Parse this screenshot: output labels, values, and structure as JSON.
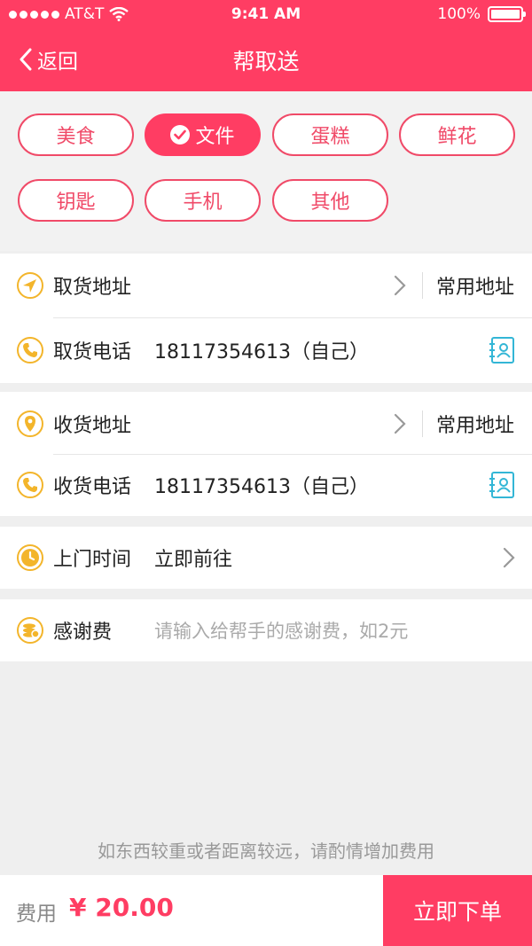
{
  "status_bar": {
    "carrier": "AT&T",
    "time": "9:41 AM",
    "battery": "100%"
  },
  "nav": {
    "back_label": "返回",
    "title": "帮取送"
  },
  "categories": [
    {
      "label": "美食",
      "selected": false
    },
    {
      "label": "文件",
      "selected": true
    },
    {
      "label": "蛋糕",
      "selected": false
    },
    {
      "label": "鲜花",
      "selected": false
    },
    {
      "label": "钥匙",
      "selected": false
    },
    {
      "label": "手机",
      "selected": false
    },
    {
      "label": "其他",
      "selected": false
    }
  ],
  "pickup": {
    "address_label": "取货地址",
    "common_address_label": "常用地址",
    "phone_label": "取货电话",
    "phone_value": "18117354613（自己）"
  },
  "delivery": {
    "address_label": "收货地址",
    "common_address_label": "常用地址",
    "phone_label": "收货电话",
    "phone_value": "18117354613（自己）"
  },
  "time": {
    "label": "上门时间",
    "value": "立即前往"
  },
  "tip": {
    "label": "感谢费",
    "placeholder": "请输入给帮手的感谢费，如2元"
  },
  "hint_text": "如东西较重或者距离较远，请酌情增加费用",
  "footer": {
    "fee_label": "费用",
    "fee_value": "¥ 20.00",
    "order_button": "立即下单"
  },
  "colors": {
    "brand": "#ff3d63",
    "icon_yellow": "#f3b52b",
    "contact_blue": "#33b6d6"
  }
}
